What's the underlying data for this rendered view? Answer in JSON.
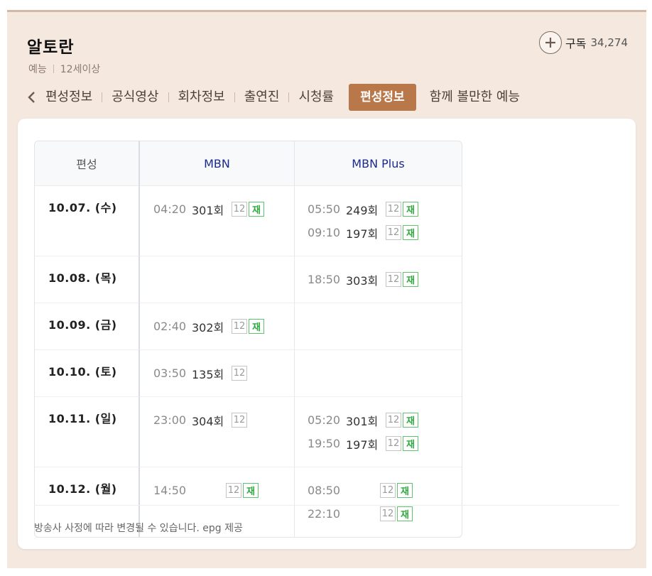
{
  "program": {
    "title": "알토란",
    "genre": "예능",
    "rating": "12세이상"
  },
  "subscribe": {
    "label": "구독",
    "count": "34,274"
  },
  "tabs": [
    {
      "label": "편성정보",
      "active": false,
      "truncated": true
    },
    {
      "label": "공식영상",
      "active": false
    },
    {
      "label": "회차정보",
      "active": false
    },
    {
      "label": "출연진",
      "active": false
    },
    {
      "label": "시청률",
      "active": false
    },
    {
      "label": "편성정보",
      "active": true
    },
    {
      "label": "함께 볼만한 예능",
      "active": false
    }
  ],
  "schedule": {
    "headers": {
      "date": "편성",
      "mbn": "MBN",
      "plus": "MBN Plus"
    },
    "rows": [
      {
        "date": "10.07. (수)",
        "mbn": [
          {
            "time": "04:20",
            "episode": "301회",
            "age": "12",
            "rerun": "재"
          }
        ],
        "plus": [
          {
            "time": "05:50",
            "episode": "249회",
            "age": "12",
            "rerun": "재"
          },
          {
            "time": "09:10",
            "episode": "197회",
            "age": "12",
            "rerun": "재"
          }
        ]
      },
      {
        "date": "10.08. (목)",
        "mbn": [],
        "plus": [
          {
            "time": "18:50",
            "episode": "303회",
            "age": "12",
            "rerun": "재"
          }
        ]
      },
      {
        "date": "10.09. (금)",
        "mbn": [
          {
            "time": "02:40",
            "episode": "302회",
            "age": "12",
            "rerun": "재"
          }
        ],
        "plus": []
      },
      {
        "date": "10.10. (토)",
        "mbn": [
          {
            "time": "03:50",
            "episode": "135회",
            "age": "12",
            "rerun": ""
          }
        ],
        "plus": []
      },
      {
        "date": "10.11. (일)",
        "mbn": [
          {
            "time": "23:00",
            "episode": "304회",
            "age": "12",
            "rerun": ""
          }
        ],
        "plus": [
          {
            "time": "05:20",
            "episode": "301회",
            "age": "12",
            "rerun": "재"
          },
          {
            "time": "19:50",
            "episode": "197회",
            "age": "12",
            "rerun": "재"
          }
        ]
      },
      {
        "date": "10.12. (월)",
        "mbn": [
          {
            "time": "14:50",
            "episode": "",
            "age": "12",
            "rerun": "재"
          }
        ],
        "plus": [
          {
            "time": "08:50",
            "episode": "",
            "age": "12",
            "rerun": "재"
          },
          {
            "time": "22:10",
            "episode": "",
            "age": "12",
            "rerun": "재"
          }
        ]
      }
    ]
  },
  "notice": "방송사 사정에 따라 변경될 수 있습니다. epg 제공"
}
